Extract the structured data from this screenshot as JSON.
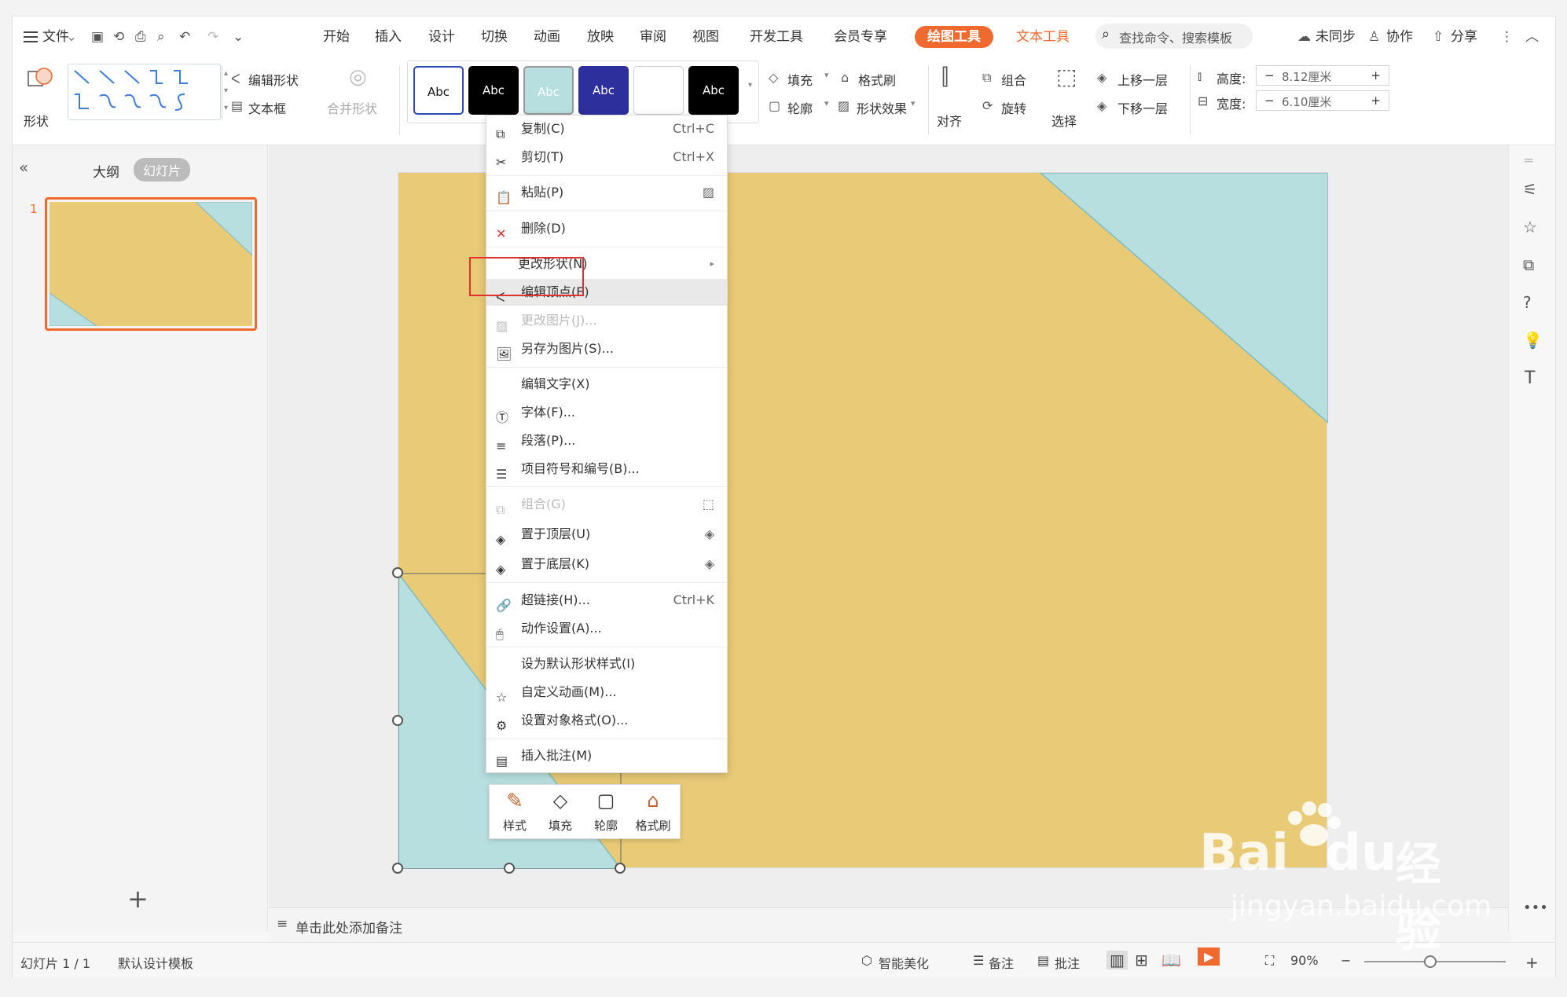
{
  "menu": {
    "file": "文件",
    "tabs": [
      "开始",
      "插入",
      "设计",
      "切换",
      "动画",
      "放映",
      "审阅",
      "视图",
      "开发工具",
      "会员专享"
    ],
    "active_tab": "绘图工具",
    "text_tool_tab": "文本工具",
    "search_placeholder": "查找命令、搜索模板",
    "sync": "未同步",
    "collab": "协作",
    "share": "分享"
  },
  "ribbon": {
    "shape": "形状",
    "edit_shape": "编辑形状",
    "textbox": "文本框",
    "merge_shape": "合并形状",
    "style_abc": [
      "Abc",
      "Abc",
      "Abc",
      "Abc",
      "",
      "Abc"
    ],
    "fill": "填充",
    "format_brush": "格式刷",
    "outline": "轮廓",
    "shape_effect": "形状效果",
    "align": "对齐",
    "group": "组合",
    "rotate": "旋转",
    "select": "选择",
    "bring_forward": "上移一层",
    "send_backward": "下移一层",
    "height_label": "高度:",
    "height_value": "8.12厘米",
    "width_label": "宽度:",
    "width_value": "6.10厘米"
  },
  "left_panel": {
    "outline_tab": "大纲",
    "slides_tab": "幻灯片",
    "slide_number": "1",
    "add": "+"
  },
  "context_menu": {
    "copy": "复制(C)",
    "copy_sc": "Ctrl+C",
    "cut": "剪切(T)",
    "cut_sc": "Ctrl+X",
    "paste": "粘贴(P)",
    "delete": "删除(D)",
    "change_shape": "更改形状(N)",
    "edit_points": "编辑顶点(E)",
    "change_picture": "更改图片(J)...",
    "save_as_picture": "另存为图片(S)...",
    "edit_text": "编辑文字(X)",
    "font": "字体(F)...",
    "paragraph": "段落(P)...",
    "bullets": "项目符号和编号(B)...",
    "group": "组合(G)",
    "bring_to_front": "置于顶层(U)",
    "send_to_back": "置于底层(K)",
    "hyperlink": "超链接(H)...",
    "hyperlink_sc": "Ctrl+K",
    "action": "动作设置(A)...",
    "default_style": "设为默认形状样式(I)",
    "custom_anim": "自定义动画(M)...",
    "format_object": "设置对象格式(O)...",
    "insert_comment": "插入批注(M)"
  },
  "mini_toolbar": {
    "style": "样式",
    "fill": "填充",
    "outline": "轮廓",
    "brush": "格式刷"
  },
  "notes": "单击此处添加备注",
  "status": {
    "slide_info": "幻灯片 1 / 1",
    "template": "默认设计模板",
    "beautify": "智能美化",
    "notes": "备注",
    "comments": "批注",
    "zoom": "90%"
  },
  "watermark": {
    "logo": "Bai",
    "logo2": "du",
    "jingyan": "经验",
    "url": "jingyan.baidu.com"
  },
  "colors": {
    "accent": "#f0692f",
    "slide_bg": "#e8ca77",
    "shape_fill": "#b8dfe0",
    "highlight_box": "#e03030"
  }
}
